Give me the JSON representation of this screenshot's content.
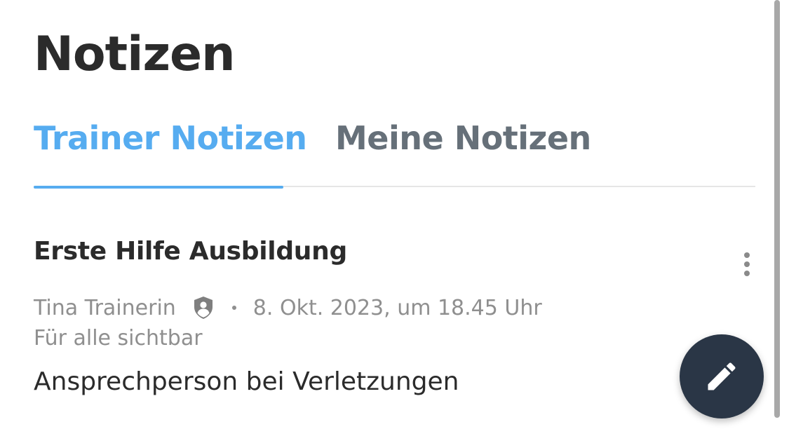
{
  "header": {
    "title": "Notizen"
  },
  "tabs": [
    {
      "label": "Trainer Notizen",
      "active": true
    },
    {
      "label": "Meine Notizen",
      "active": false
    }
  ],
  "note": {
    "title": "Erste Hilfe Ausbildung",
    "author": "Tina Trainerin",
    "author_icon": "shield-person-icon",
    "separator": "•",
    "date": "8. Okt. 2023, um 18.45 Uhr",
    "visibility": "Für alle sichtbar",
    "body": "Ansprechperson bei Verletzungen",
    "menu_icon": "more-vertical-icon"
  },
  "fab": {
    "icon": "edit-pencil-icon"
  },
  "colors": {
    "accent": "#56acf0",
    "text_primary": "#2b2b2b",
    "text_secondary": "#8f8f8f",
    "tab_inactive": "#667079",
    "fab_background": "#2a3646"
  }
}
